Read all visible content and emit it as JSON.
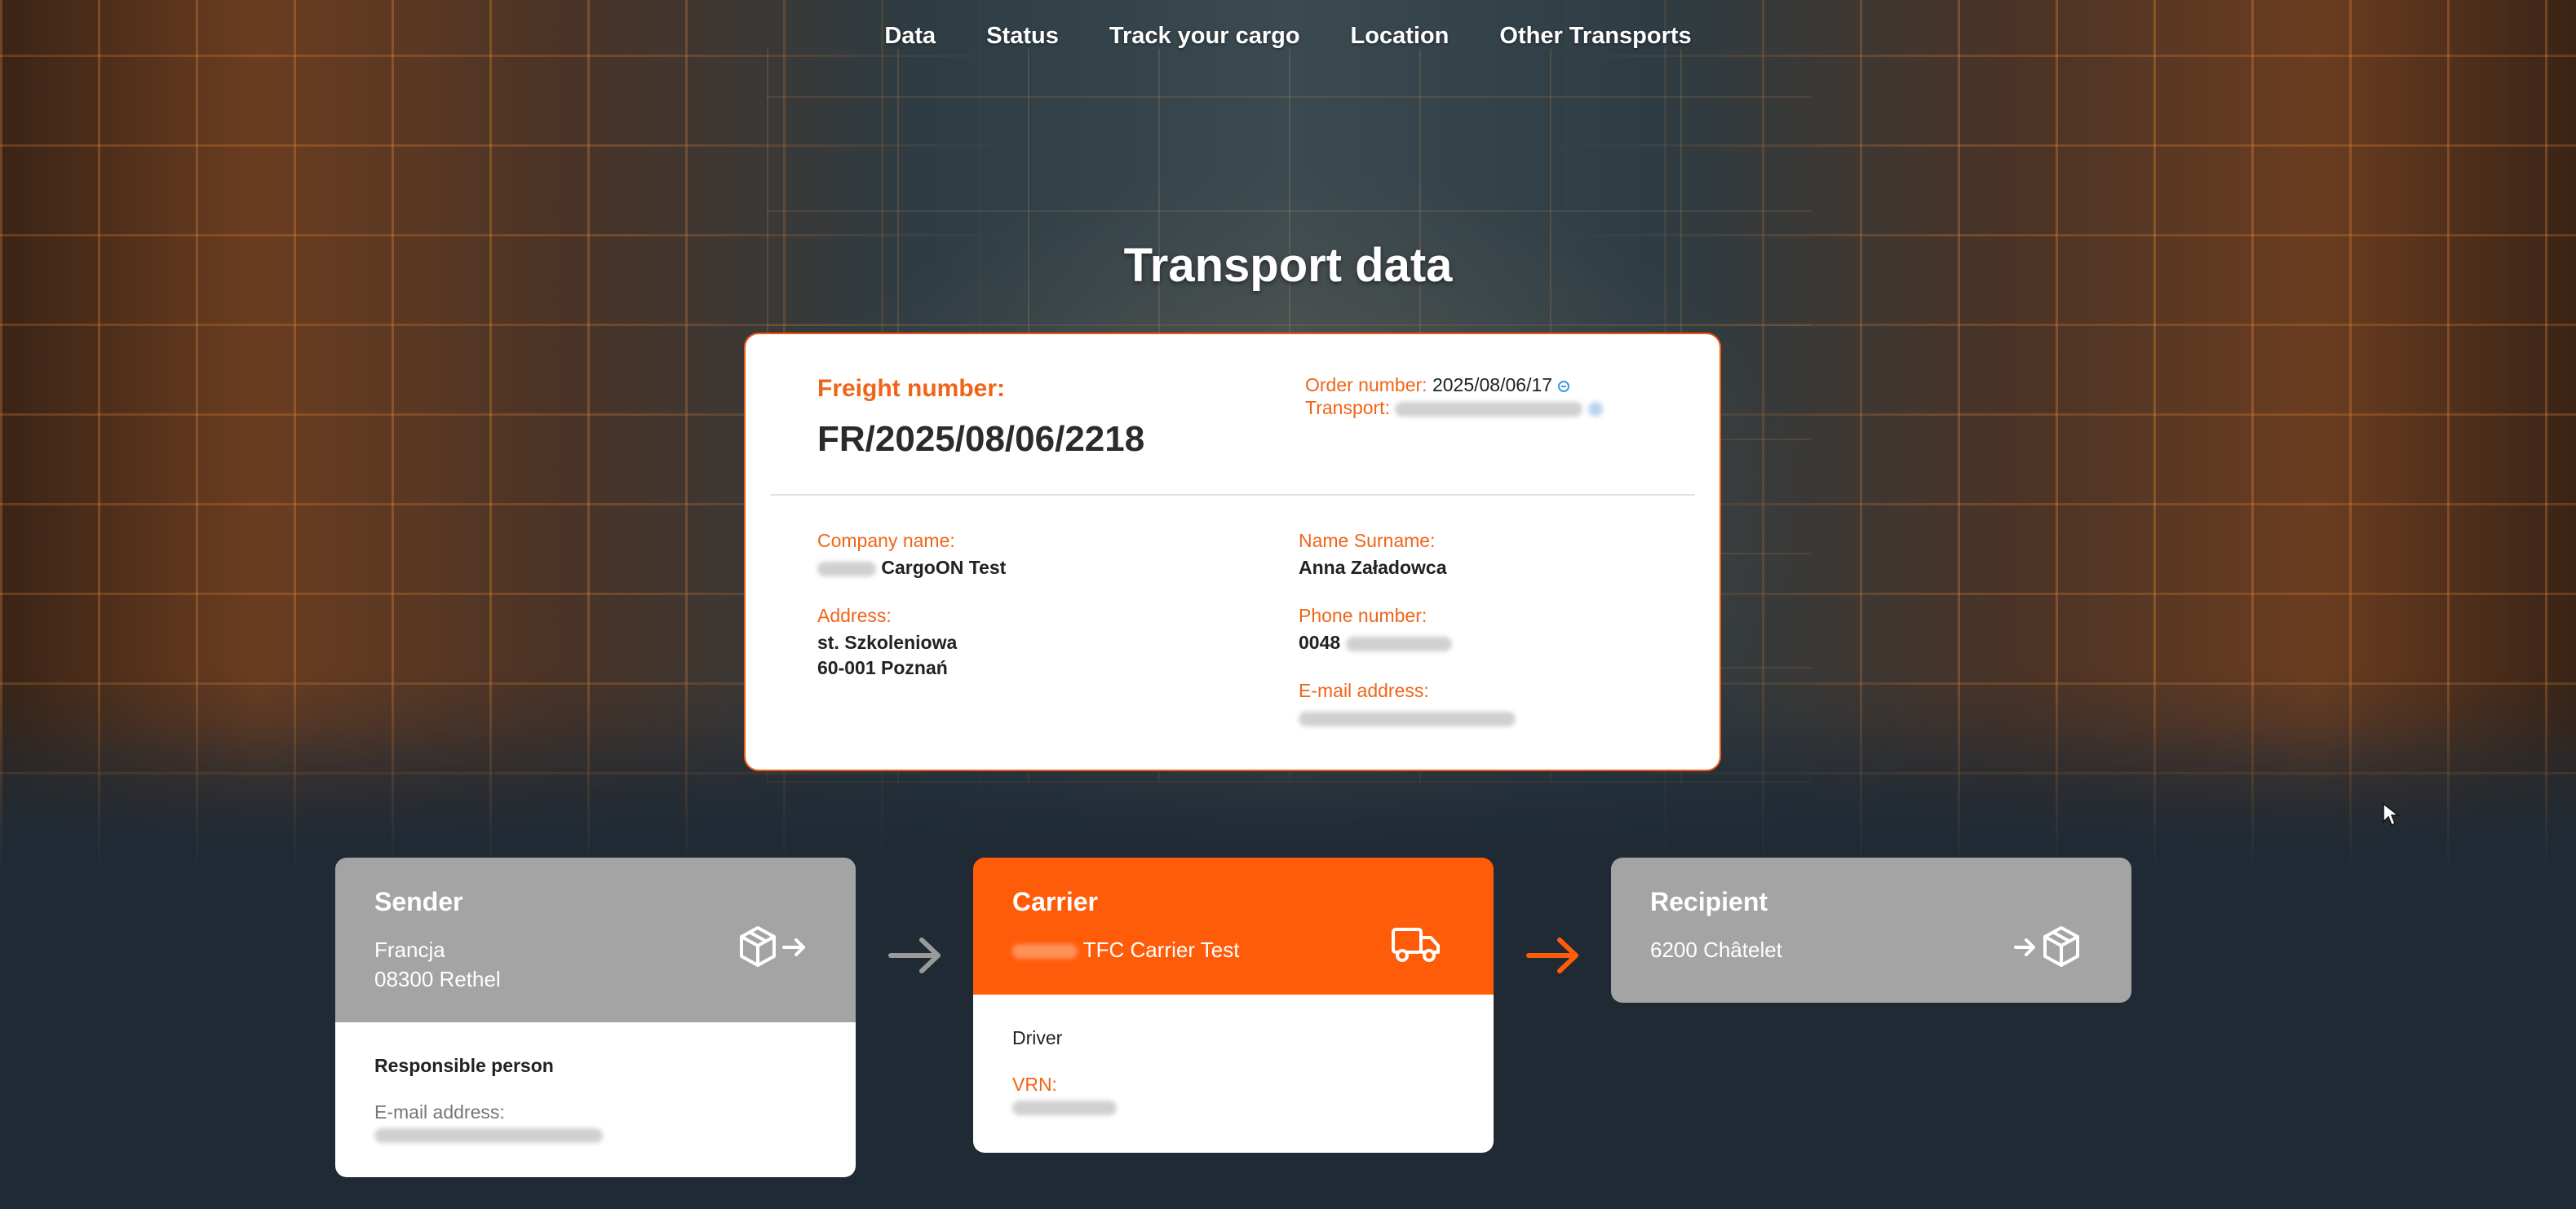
{
  "nav": {
    "items": [
      {
        "label": "Data"
      },
      {
        "label": "Status"
      },
      {
        "label": "Track your cargo"
      },
      {
        "label": "Location"
      },
      {
        "label": "Other Transports"
      }
    ]
  },
  "page": {
    "title": "Transport data"
  },
  "freight": {
    "label": "Freight number:",
    "value": "FR/2025/08/06/2218",
    "order_label": "Order number:",
    "order_value": "2025/08/06/17",
    "transport_label": "Transport:"
  },
  "company": {
    "company_label": "Company name:",
    "company_value": "CargoON Test",
    "address_label": "Address:",
    "address_line1": "st. Szkoleniowa",
    "address_line2": "60-001 Poznań",
    "name_label": "Name Surname:",
    "name_value": "Anna Załadowca",
    "phone_label": "Phone number:",
    "phone_prefix": "0048",
    "email_label": "E-mail address:"
  },
  "sender": {
    "title": "Sender",
    "line1": "Francja",
    "line2": "08300 Rethel",
    "responsible_title": "Responsible person",
    "email_label": "E-mail address:",
    "icon": "package-send-icon"
  },
  "carrier": {
    "title": "Carrier",
    "company": "TFC Carrier Test",
    "driver_title": "Driver",
    "vrn_label": "VRN:",
    "icon": "truck-icon"
  },
  "recipient": {
    "title": "Recipient",
    "line1": "6200 Châtelet",
    "icon": "package-receive-icon"
  },
  "colors": {
    "accent": "#ff5c0a",
    "label_orange": "#f06418",
    "card_gray": "#a4a4a4"
  }
}
